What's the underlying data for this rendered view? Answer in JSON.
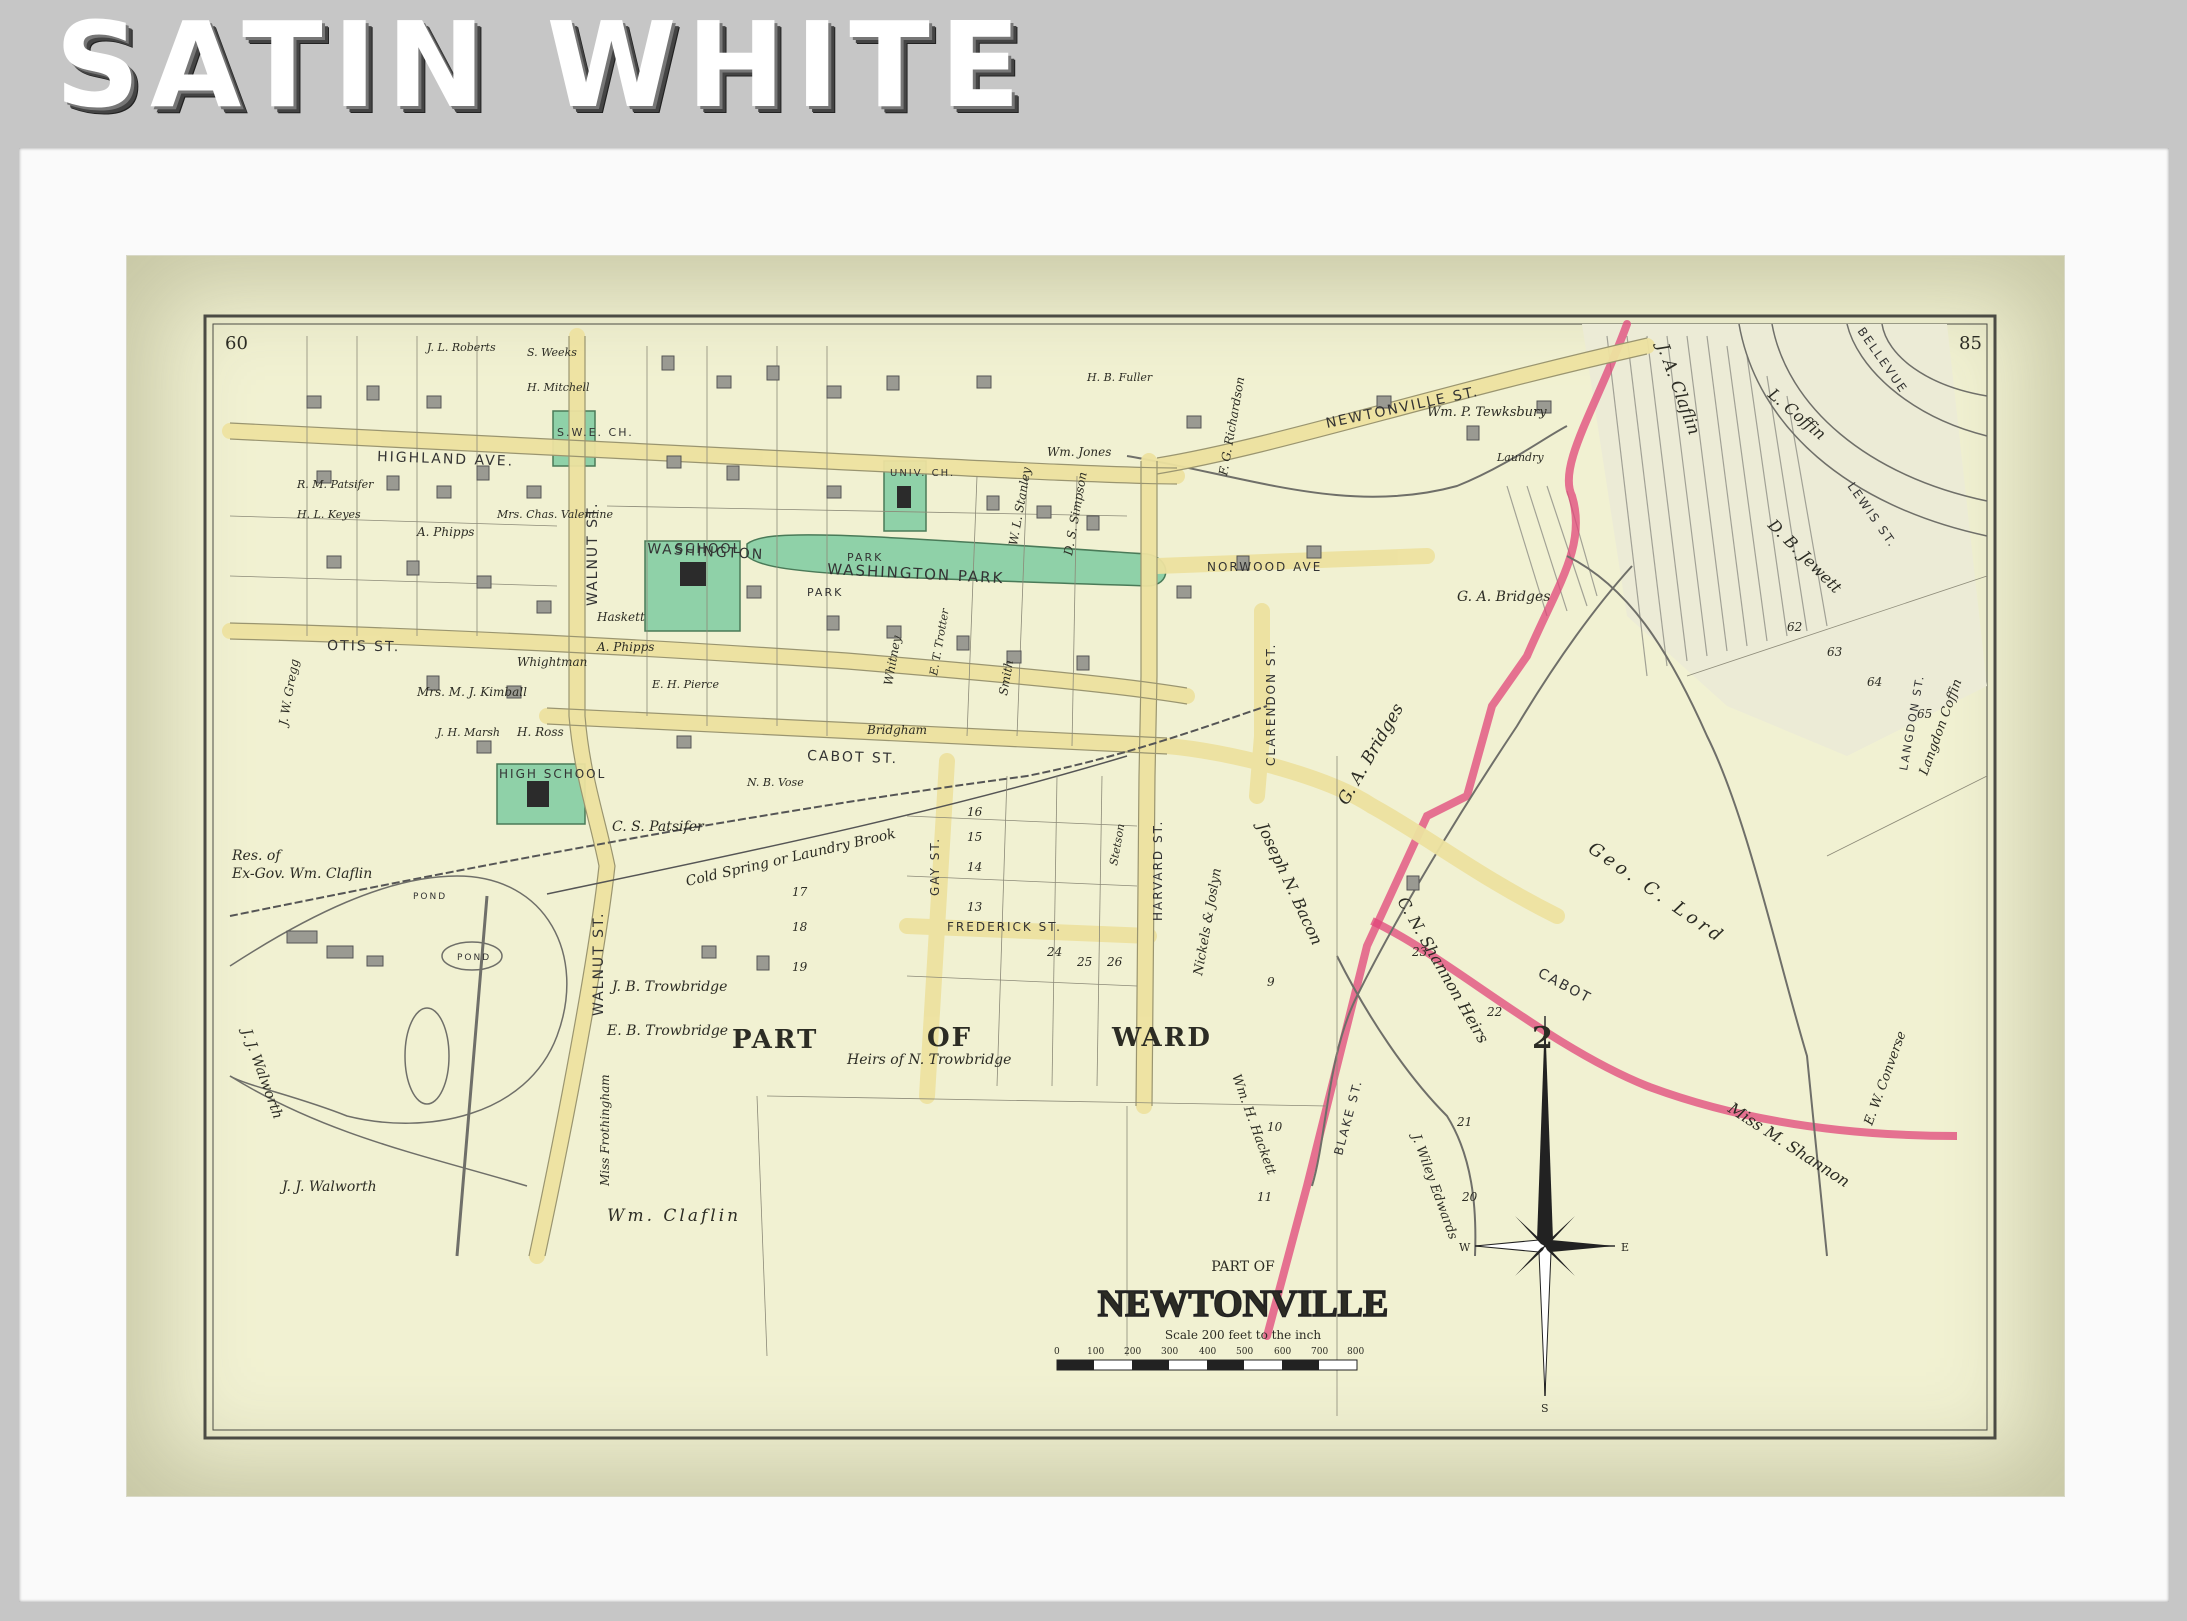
{
  "banner": {
    "title": "SATIN WHITE"
  },
  "map": {
    "page_left": "60",
    "page_right": "85",
    "title_small": "PART OF",
    "title": "NEWTONVILLE",
    "scale": "Scale 200 feet to the inch",
    "scale_ticks": [
      "0",
      "100",
      "200",
      "300",
      "400",
      "500",
      "600",
      "700",
      "800"
    ],
    "ward_parts": [
      "PART",
      "OF",
      "WARD"
    ],
    "ward_number": "2",
    "compass_letters": [
      "W",
      "E",
      "S"
    ],
    "colors": {
      "ward_boundary": "#e0457a",
      "public_green": "#8fd1a8",
      "road": "#f0e6a8"
    },
    "streets": {
      "highland": "HIGHLAND AVE.",
      "washington": "WASHINGTON",
      "washington_park_top": "PARK",
      "washington_park_bottom": "PARK",
      "washington_park_band": "WASHINGTON PARK",
      "otis": "OTIS ST.",
      "cabot": "CABOT ST.",
      "cabot_east": "CABOT",
      "norwood": "NORWOOD AVE",
      "newtonville": "NEWTONVILLE ST.",
      "walnut_north": "WALNUT ST.",
      "walnut_south": "WALNUT ST.",
      "clarendon": "CLARENDON ST.",
      "harvard": "HARVARD ST.",
      "gay": "GAY ST.",
      "frederick": "FREDERICK ST.",
      "blake": "BLAKE ST.",
      "lewis": "LEWIS ST.",
      "bellevue": "BELLEVUE",
      "langdon": "LANGDON ST.",
      "pond": "POND",
      "pond2": "POND",
      "brook": "Cold Spring or Laundry Brook"
    },
    "buildings": {
      "swe_church": "S.W.E. CH.",
      "school": "SCHOOL",
      "univ_church": "UNIV. CH.",
      "high_school": "HIGH SCHOOL"
    },
    "owners": {
      "claflin_res": "Res. of",
      "claflin_res2": "Ex-Gov. Wm. Claflin",
      "walworth1": "J. J. Walworth",
      "walworth2": "J. J. Walworth",
      "wm_claflin": "Wm. Claflin",
      "trowbridge_jb": "J. B. Trowbridge",
      "trowbridge_eb": "E. B. Trowbridge",
      "heirs_trowbridge": "Heirs of N. Trowbridge",
      "frothingham": "Miss Frothingham",
      "patsifer": "C. S. Patsifer",
      "ga_bridges1": "G. A. Bridges",
      "ga_bridges2": "G. A. Bridges",
      "ja_claflin": "J. A. Claflin",
      "geo_lord": "Geo. C. Lord",
      "shannon_heirs": "C. N. Shannon Heirs",
      "joseph_bacon": "Joseph N. Bacon",
      "miss_shannon": "Miss M. Shannon",
      "tewksbury": "Wm. P. Tewksbury",
      "jewett": "D. B. Jewett",
      "coffin1": "L. Coffin",
      "coffin2": "Langdon Coffin",
      "converse": "E. W. Converse",
      "edwards": "J. Wiley Edwards",
      "hackett": "Wm. H. Hackett",
      "nichols": "Nickels & Joslyn",
      "kimball": "Mrs. M. J. Kimball",
      "whightman": "Whightman",
      "hross": "H. Ross",
      "jw_gregg": "J. W. Gregg",
      "haskett": "Haskett",
      "phipps1": "A. Phipps",
      "phipps2": "A. Phipps",
      "stanley": "W. L. Stanley",
      "simpson": "D. S. Simpson",
      "whitney": "Whitney",
      "bridgham": "Bridgham",
      "smith": "Smith",
      "wm_jones": "Wm. Jones",
      "richardson": "F. G. Richardson",
      "patsifer2": "R. M. Patsifer",
      "keyes": "H. L. Keyes",
      "valentine": "Mrs. Chas. Valentine",
      "roberts": "J. L. Roberts",
      "weeks": "S. Weeks",
      "mitchell": "H. Mitchell",
      "fuller": "H. B. Fuller",
      "laundry": "Laundry",
      "vose": "N. B. Vose",
      "trotter": "E. T. Trotter",
      "stetson": "Stetson",
      "marsh": "J. H. Marsh",
      "pierce": "E. H. Pierce"
    },
    "lot_numbers": [
      "9",
      "10",
      "11",
      "21",
      "20",
      "22",
      "23",
      "24",
      "25",
      "26",
      "17",
      "18",
      "19",
      "13",
      "14",
      "15",
      "16",
      "65",
      "64",
      "63",
      "62"
    ]
  }
}
